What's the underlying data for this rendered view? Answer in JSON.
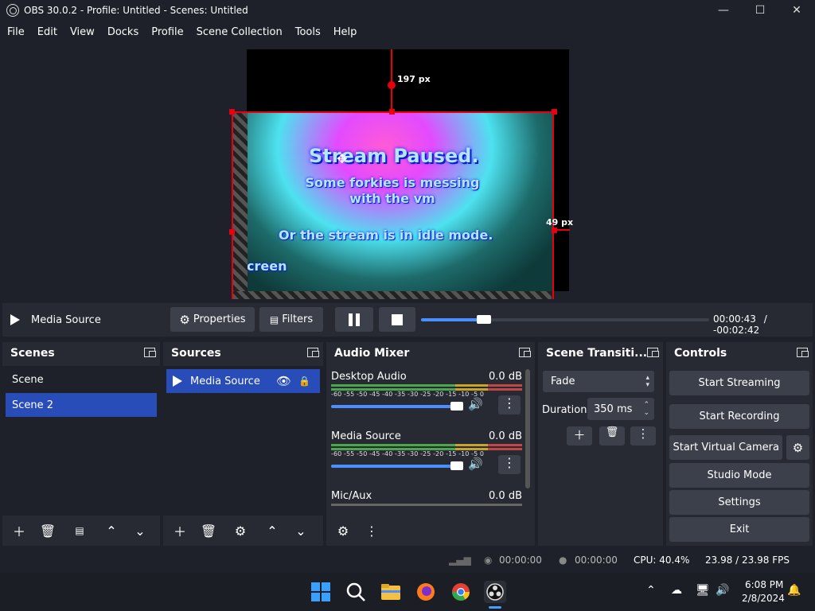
{
  "window": {
    "title": "OBS 30.0.2 - Profile: Untitled - Scenes: Untitled",
    "min": "—",
    "max": "☐",
    "close": "✕"
  },
  "menu": [
    "File",
    "Edit",
    "View",
    "Docks",
    "Profile",
    "Scene Collection",
    "Tools",
    "Help"
  ],
  "preview": {
    "line1": "Stream Paused.",
    "line2": "Some forkies is messing with the vm",
    "line3": "Or the stream is in idle mode.",
    "line4": "creen",
    "measure_top": "197 px",
    "measure_right": "49 px"
  },
  "media_controls": {
    "source_name": "Media Source",
    "properties_label": "Properties",
    "filters_label": "Filters",
    "progress": 0.21,
    "time_current": "00:00:43",
    "time_sep": "/",
    "time_remaining": "-00:02:42"
  },
  "scenes": {
    "title": "Scenes",
    "items": [
      "Scene",
      "Scene 2"
    ],
    "selected": "Scene 2"
  },
  "sources": {
    "title": "Sources",
    "items": [
      {
        "name": "Media Source",
        "visible": true,
        "locked": false
      }
    ]
  },
  "audio_mixer": {
    "title": "Audio Mixer",
    "ticks": "-60 -55 -50 -45 -40 -35 -30 -25 -20 -15 -10 -5 0",
    "tracks": [
      {
        "name": "Desktop Audio",
        "level": "0.0 dB",
        "volume": 1.0
      },
      {
        "name": "Media Source",
        "level": "0.0 dB",
        "volume": 1.0
      },
      {
        "name": "Mic/Aux",
        "level": "0.0 dB",
        "volume": 1.0
      }
    ]
  },
  "transitions": {
    "title": "Scene Transiti...",
    "selected": "Fade",
    "duration_label": "Duration",
    "duration_value": "350 ms"
  },
  "controls": {
    "title": "Controls",
    "start_streaming": "Start Streaming",
    "start_recording": "Start Recording",
    "start_virtual_camera": "Start Virtual Camera",
    "studio_mode": "Studio Mode",
    "settings": "Settings",
    "exit": "Exit"
  },
  "status": {
    "stream_time": "00:00:00",
    "rec_time": "00:00:00",
    "cpu": "CPU: 40.4%",
    "fps": "23.98 / 23.98 FPS"
  },
  "taskbar": {
    "time": "6:08 PM",
    "date": "2/8/2024"
  },
  "colors": {
    "accent": "#284cb8",
    "selection": "#e8000e",
    "panel": "#272a33",
    "background": "#1e2129"
  }
}
